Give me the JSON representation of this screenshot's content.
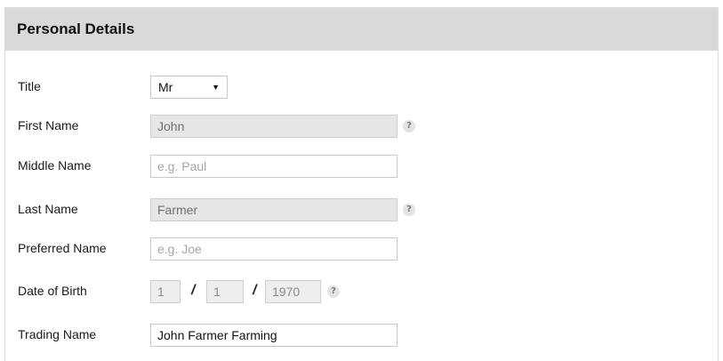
{
  "panel": {
    "title": "Personal Details"
  },
  "form": {
    "title": {
      "label": "Title",
      "selected": "Mr"
    },
    "first_name": {
      "label": "First Name",
      "value": "John"
    },
    "middle_name": {
      "label": "Middle Name",
      "placeholder": "e.g. Paul"
    },
    "last_name": {
      "label": "Last Name",
      "value": "Farmer"
    },
    "preferred_name": {
      "label": "Preferred Name",
      "placeholder": "e.g. Joe"
    },
    "date_of_birth": {
      "label": "Date of Birth",
      "day": "1",
      "month": "1",
      "year": "1970",
      "separator": "/"
    },
    "trading_name": {
      "label": "Trading Name",
      "value": "John Farmer Farming"
    }
  },
  "help_icon": {
    "glyph": "?"
  },
  "icons": {
    "dropdown": "caret-down-icon",
    "help": "help-icon"
  }
}
